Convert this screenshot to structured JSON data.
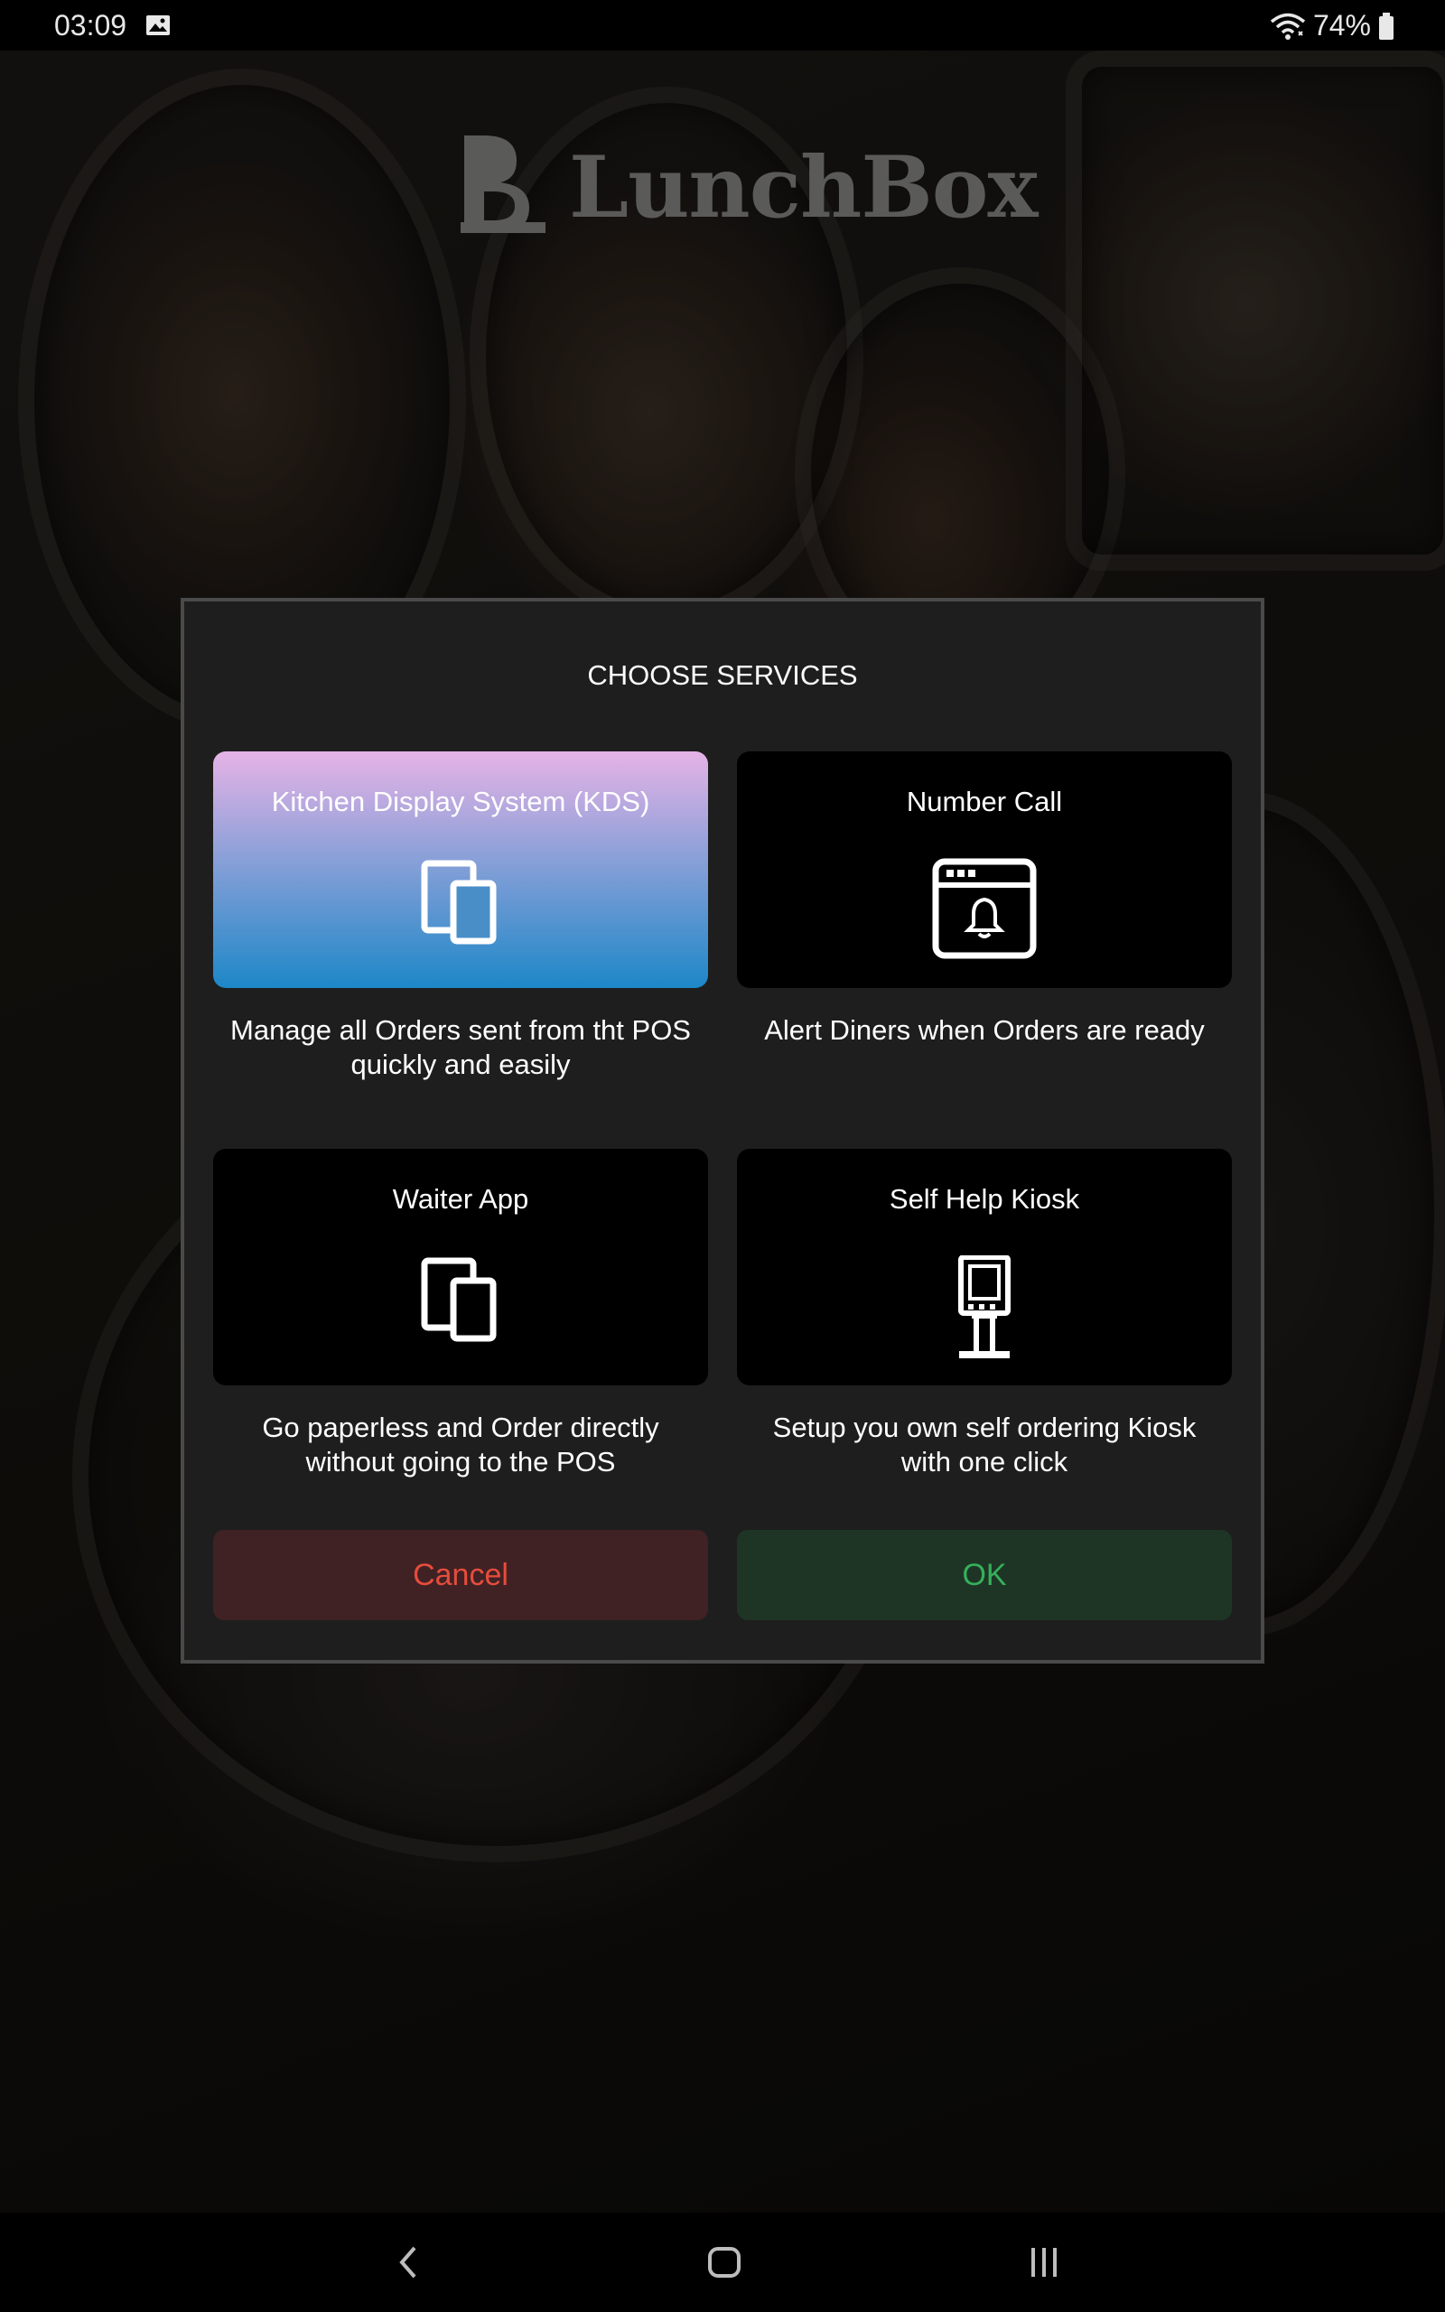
{
  "status_bar": {
    "time": "03:09",
    "battery": "74%",
    "icons": [
      "gallery-icon",
      "wifi-icon",
      "battery-icon"
    ]
  },
  "app": {
    "logo_text": "LunchBox"
  },
  "dialog": {
    "title": "CHOOSE SERVICES",
    "services": [
      {
        "title": "Kitchen Display System (KDS)",
        "icon": "devices-icon",
        "description_line1": "Manage all Orders sent from tht POS",
        "description_line2": "quickly and easily",
        "selected": true
      },
      {
        "title": "Number Call",
        "icon": "bell-window-icon",
        "description_line1": "Alert Diners when Orders are ready",
        "description_line2": "",
        "selected": false
      },
      {
        "title": "Waiter App",
        "icon": "devices-icon",
        "description_line1": "Go paperless and Order directly",
        "description_line2": "without going to the POS",
        "selected": false
      },
      {
        "title": "Self Help Kiosk",
        "icon": "kiosk-icon",
        "description_line1": "Setup you own self ordering Kiosk",
        "description_line2": "with one click",
        "selected": false
      }
    ],
    "cancel_label": "Cancel",
    "ok_label": "OK"
  },
  "colors": {
    "dialog_bg": "#1e1e1e",
    "selected_gradient_top": "#e6b3e6",
    "selected_gradient_bottom": "#1d87c7",
    "cancel_text": "#e74c3c",
    "ok_text": "#35b05a"
  },
  "nav_bar": {
    "icons": [
      "back-icon",
      "home-icon",
      "recents-icon"
    ]
  }
}
